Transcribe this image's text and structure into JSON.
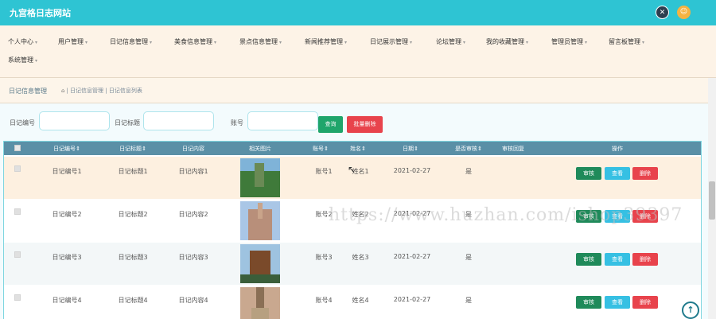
{
  "header": {
    "title": "九宫格日志网站",
    "settings_icon": "settings-icon",
    "user_icon": "user-avatar-icon"
  },
  "menu": [
    {
      "label": "个人中心"
    },
    {
      "label": "用户管理"
    },
    {
      "label": "日记信息管理"
    },
    {
      "label": "美食信息管理"
    },
    {
      "label": "景点信息管理"
    },
    {
      "label": "新闻推荐管理"
    },
    {
      "label": "日记展示管理"
    },
    {
      "label": "论坛管理"
    },
    {
      "label": "我的收藏管理"
    },
    {
      "label": "管理员管理"
    },
    {
      "label": "留言板管理"
    },
    {
      "label": "系统管理"
    }
  ],
  "breadcrumb": {
    "section": "日记信息管理",
    "home_icon": "home-icon",
    "path": "| 日记信息管理 | 日记信息列表"
  },
  "search": {
    "fields": [
      {
        "label": "日记编号",
        "value": ""
      },
      {
        "label": "日记标题",
        "value": ""
      },
      {
        "label": "账号",
        "value": ""
      }
    ],
    "search_button": "查询",
    "batch_delete_button": "批量删除"
  },
  "table": {
    "headers": [
      "日记编号",
      "日记标题",
      "日记内容",
      "相关图片",
      "账号",
      "姓名",
      "日期",
      "是否审核",
      "审核回复",
      "操作"
    ],
    "rows": [
      {
        "no": "日记编号1",
        "title": "日记标题1",
        "content": "日记内容1",
        "account": "账号1",
        "name": "姓名1",
        "date": "2021-02-27",
        "reviewed": "是",
        "reply": "",
        "image_colors": [
          "#7fb3d8",
          "#3f7a3a",
          "#6a8a55"
        ]
      },
      {
        "no": "日记编号2",
        "title": "日记标题2",
        "content": "日记内容2",
        "account": "账号2",
        "name": "姓名2",
        "date": "2021-02-27",
        "reviewed": "是",
        "reply": "",
        "image_colors": [
          "#a9c6e6",
          "#b88f7a",
          "#c9a48a"
        ]
      },
      {
        "no": "日记编号3",
        "title": "日记标题3",
        "content": "日记内容3",
        "account": "账号3",
        "name": "姓名3",
        "date": "2021-02-27",
        "reviewed": "是",
        "reply": "",
        "image_colors": [
          "#9ec3e0",
          "#7a4a2a",
          "#3a5e3a"
        ]
      },
      {
        "no": "日记编号4",
        "title": "日记标题4",
        "content": "日记内容4",
        "account": "账号4",
        "name": "姓名4",
        "date": "2021-02-27",
        "reviewed": "是",
        "reply": "",
        "image_colors": [
          "#c9a88f",
          "#8a6f55",
          "#b7a080"
        ]
      }
    ],
    "actions": {
      "review": "审核",
      "view": "查看",
      "delete": "删除"
    }
  },
  "watermark": "https://www.huzhan.com/ishop39397",
  "colors": {
    "topbar": "#2ec4d3",
    "review": "#1f8a5a",
    "view": "#36c0e3",
    "delete": "#e8434c"
  }
}
